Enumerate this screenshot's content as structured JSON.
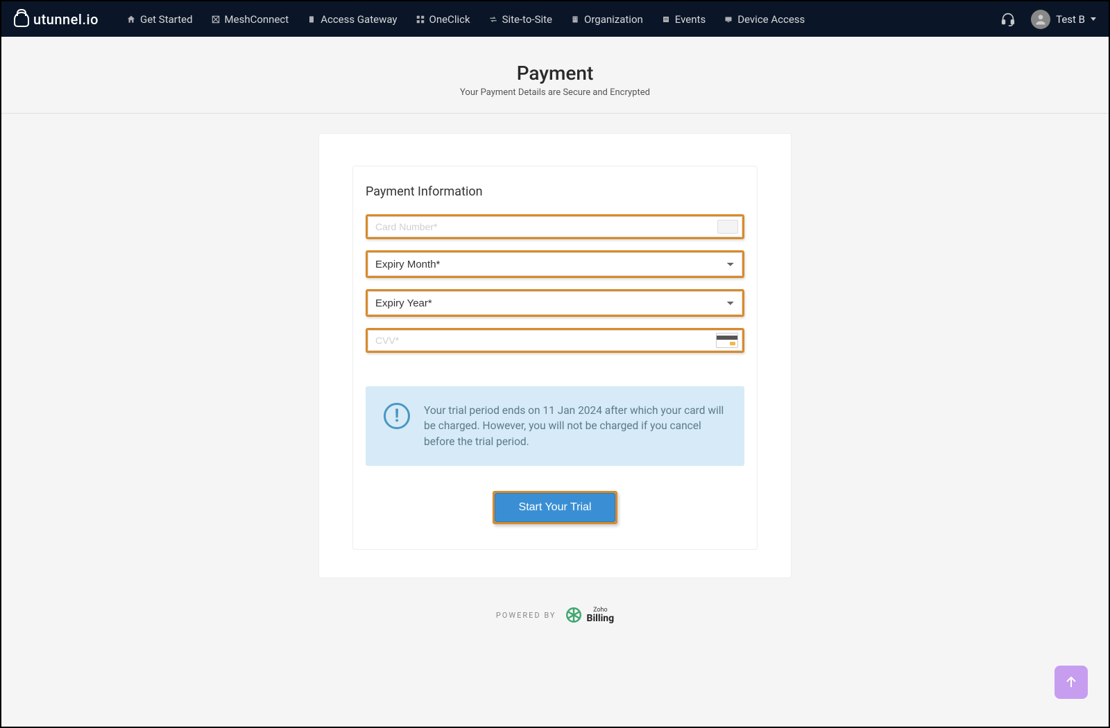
{
  "brand": {
    "name": "utunnel.io"
  },
  "nav": {
    "items": [
      {
        "label": "Get Started"
      },
      {
        "label": "MeshConnect"
      },
      {
        "label": "Access Gateway"
      },
      {
        "label": "OneClick"
      },
      {
        "label": "Site-to-Site"
      },
      {
        "label": "Organization"
      },
      {
        "label": "Events"
      },
      {
        "label": "Device Access"
      }
    ],
    "user": "Test B"
  },
  "page": {
    "title": "Payment",
    "subtitle": "Your Payment Details are Secure and Encrypted"
  },
  "form": {
    "heading": "Payment Information",
    "card_placeholder": "Card Number*",
    "expiry_month_label": "Expiry Month*",
    "expiry_year_label": "Expiry Year*",
    "cvv_placeholder": "CVV*",
    "notice": "Your trial period ends on 11 Jan 2024 after which your card will be charged. However, you will not be charged if you cancel before the trial period.",
    "cta": "Start Your Trial"
  },
  "footer": {
    "powered_by": "POWERED BY",
    "provider_small": "Zoho",
    "provider_big": "Billing"
  },
  "colors": {
    "highlight": "#d98a2a",
    "primary": "#3a8fd4",
    "notice_bg": "#d6ebf7"
  }
}
